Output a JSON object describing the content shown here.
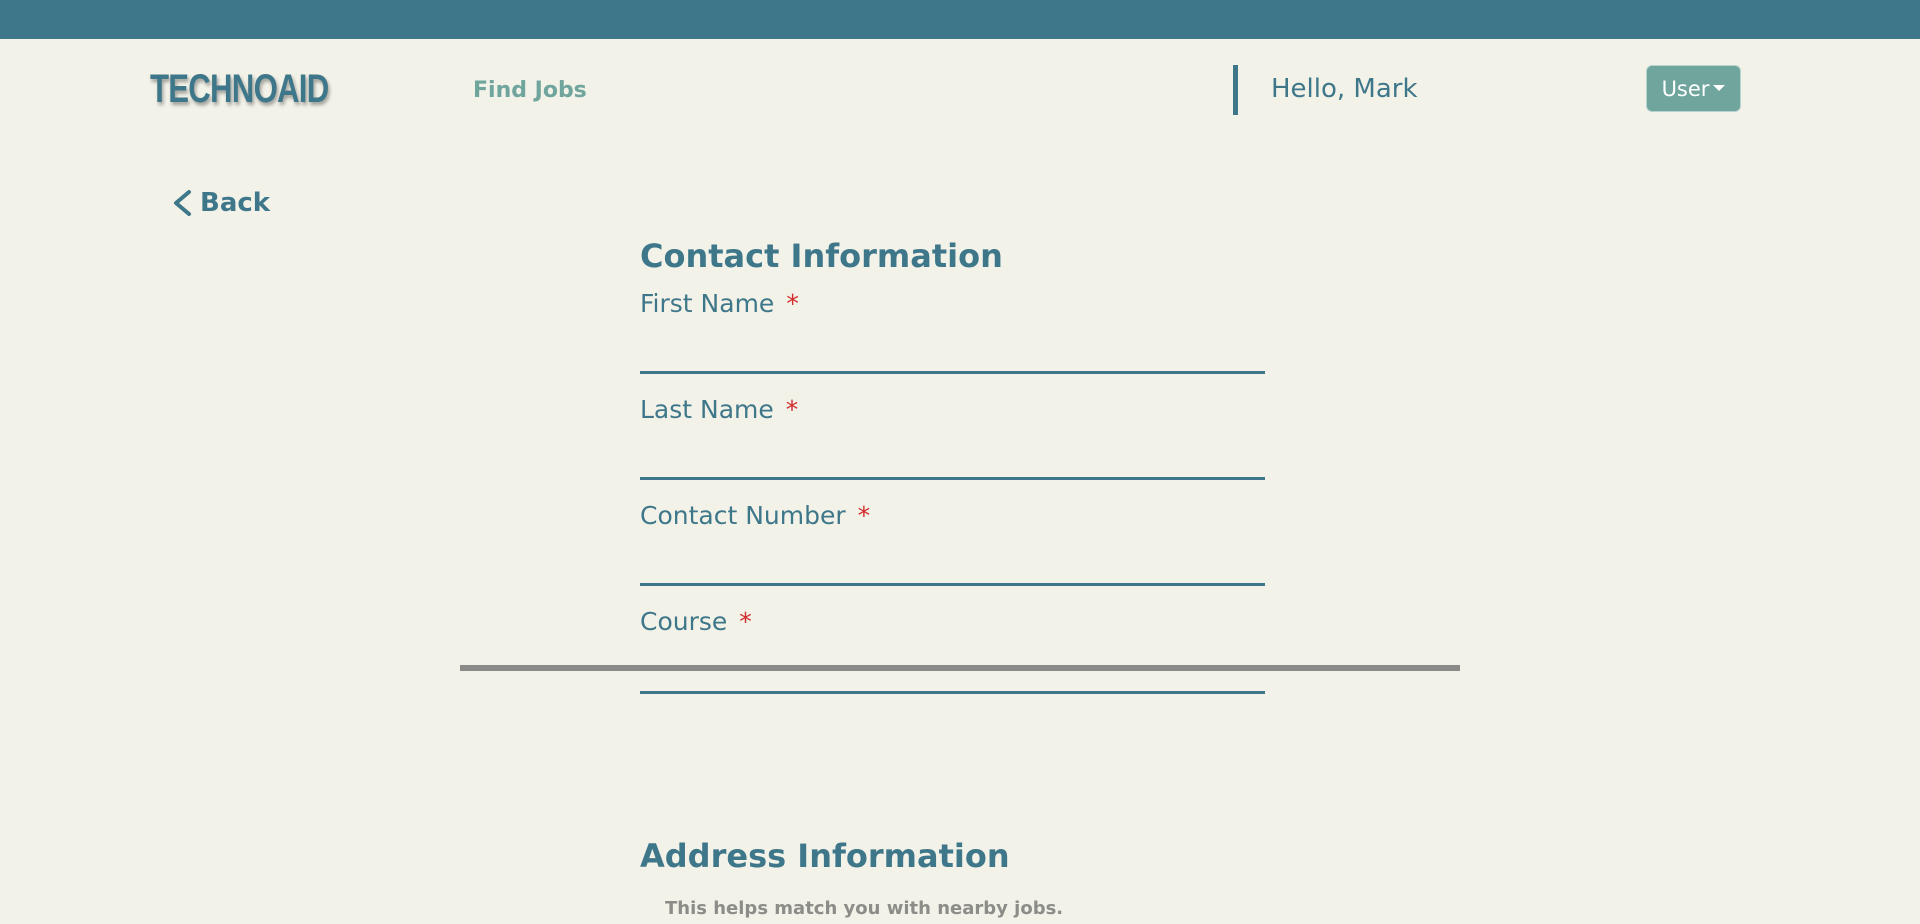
{
  "header": {
    "logo": "TECHNOAID",
    "nav_link": "Find Jobs",
    "greeting": "Hello, Mark",
    "user_menu_label": "User",
    "colors": {
      "topbar": "#3f778a",
      "accent": "#6fa59d",
      "background": "#f2f2e9"
    }
  },
  "back": {
    "label": "Back",
    "icon": "chevron-left-icon"
  },
  "contact_section": {
    "title": "Contact Information",
    "fields": [
      {
        "label": "First Name",
        "required_mark": "*",
        "value": ""
      },
      {
        "label": "Last Name",
        "required_mark": "*",
        "value": ""
      },
      {
        "label": "Contact Number",
        "required_mark": "*",
        "value": ""
      },
      {
        "label": "Course",
        "required_mark": "*",
        "value": ""
      }
    ]
  },
  "address_section": {
    "title": "Address Information",
    "hint": "This helps match you with nearby jobs."
  }
}
